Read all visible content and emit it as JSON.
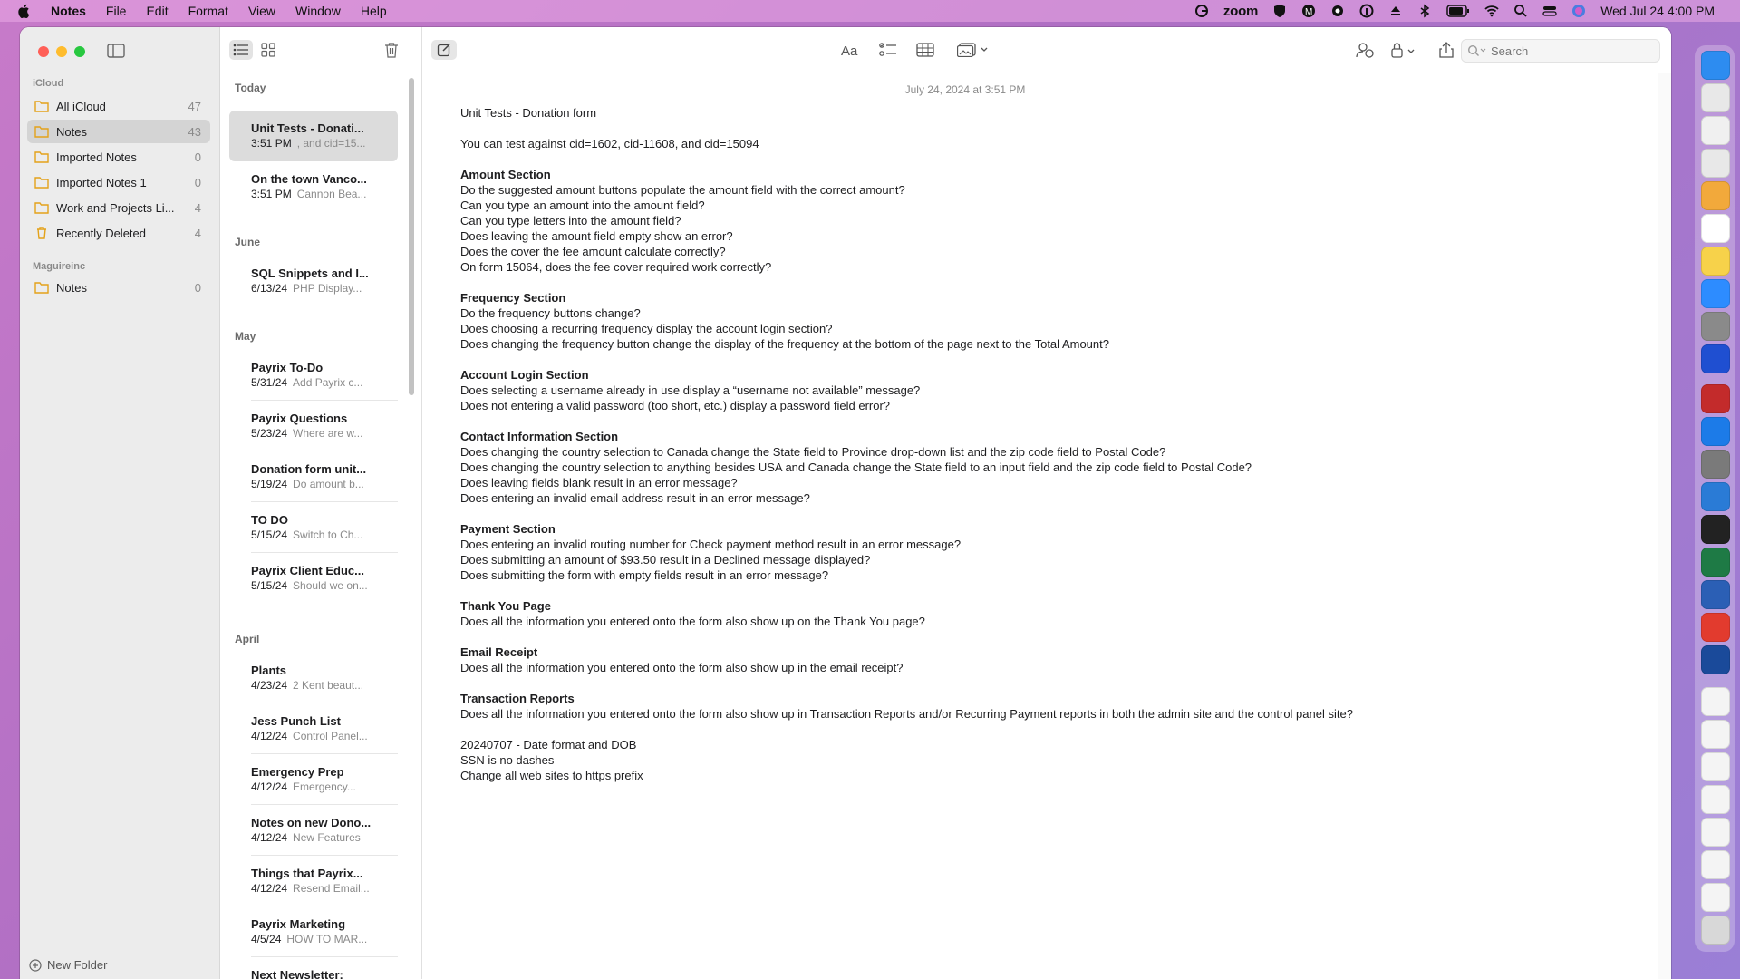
{
  "menubar": {
    "app_name": "Notes",
    "menus": [
      "File",
      "Edit",
      "Format",
      "View",
      "Window",
      "Help"
    ],
    "zoom_label": "zoom",
    "clock": "Wed Jul 24  4:00 PM"
  },
  "sidebar": {
    "groups": [
      {
        "label": "iCloud",
        "folders": [
          {
            "name": "All iCloud",
            "count": "47"
          },
          {
            "name": "Notes",
            "count": "43"
          },
          {
            "name": "Imported Notes",
            "count": "0"
          },
          {
            "name": "Imported Notes 1",
            "count": "0"
          },
          {
            "name": "Work and Projects Li...",
            "count": "4"
          },
          {
            "name": "Recently Deleted",
            "count": "4"
          }
        ]
      },
      {
        "label": "Maguireinc",
        "folders": [
          {
            "name": "Notes",
            "count": "0"
          }
        ]
      }
    ],
    "new_folder_label": "New Folder"
  },
  "notelist": {
    "sections": [
      {
        "label": "Today",
        "notes": [
          {
            "title": "Unit Tests - Donati...",
            "date": "3:51 PM",
            "preview": ", and cid=15..."
          },
          {
            "title": "On the town Vanco...",
            "date": "3:51 PM",
            "preview": "Cannon Bea..."
          }
        ]
      },
      {
        "label": "June",
        "notes": [
          {
            "title": "SQL Snippets and I...",
            "date": "6/13/24",
            "preview": "PHP Display..."
          }
        ]
      },
      {
        "label": "May",
        "notes": [
          {
            "title": "Payrix To-Do",
            "date": "5/31/24",
            "preview": "Add Payrix c..."
          },
          {
            "title": "Payrix Questions",
            "date": "5/23/24",
            "preview": "Where are w..."
          },
          {
            "title": "Donation form unit...",
            "date": "5/19/24",
            "preview": "Do amount b..."
          },
          {
            "title": "TO DO",
            "date": "5/15/24",
            "preview": "Switch to Ch..."
          },
          {
            "title": "Payrix Client Educ...",
            "date": "5/15/24",
            "preview": "Should we on..."
          }
        ]
      },
      {
        "label": "April",
        "notes": [
          {
            "title": "Plants",
            "date": "4/23/24",
            "preview": "2 Kent beaut..."
          },
          {
            "title": "Jess Punch List",
            "date": "4/12/24",
            "preview": "Control Panel..."
          },
          {
            "title": "Emergency Prep",
            "date": "4/12/24",
            "preview": "Emergency..."
          },
          {
            "title": "Notes on new Dono...",
            "date": "4/12/24",
            "preview": "New Features"
          },
          {
            "title": "Things that Payrix...",
            "date": "4/12/24",
            "preview": "Resend Email..."
          },
          {
            "title": "Payrix Marketing",
            "date": "4/5/24",
            "preview": "HOW TO MAR..."
          },
          {
            "title": "Next Newsletter:",
            "date": "",
            "preview": ""
          }
        ]
      }
    ]
  },
  "editor": {
    "search_placeholder": "Search",
    "note_date": "July 24, 2024 at 3:51 PM",
    "lines": [
      {
        "text": "Unit Tests - Donation form",
        "bold": false
      },
      {
        "text": "",
        "bold": false
      },
      {
        "text": "You can test against cid=1602, cid-11608, and cid=15094",
        "bold": false
      },
      {
        "text": "",
        "bold": false
      },
      {
        "text": "Amount Section",
        "bold": true
      },
      {
        "text": "Do the suggested amount buttons populate the amount field with the correct amount?",
        "bold": false
      },
      {
        "text": "Can you type an amount into the amount field?",
        "bold": false
      },
      {
        "text": "Can you type letters into the amount field?",
        "bold": false
      },
      {
        "text": "Does leaving the amount field empty show an error?",
        "bold": false
      },
      {
        "text": "Does the cover the fee amount calculate correctly?",
        "bold": false
      },
      {
        "text": "On form 15064, does the fee cover required work correctly?",
        "bold": false
      },
      {
        "text": "",
        "bold": false
      },
      {
        "text": "Frequency Section",
        "bold": true
      },
      {
        "text": "Do the frequency buttons change?",
        "bold": false
      },
      {
        "text": "Does choosing a recurring frequency display the account login section?",
        "bold": false
      },
      {
        "text": "Does changing the frequency button change the display of the frequency at the bottom of the page next to the Total Amount?",
        "bold": false
      },
      {
        "text": "",
        "bold": false
      },
      {
        "text": "Account Login Section",
        "bold": true
      },
      {
        "text": "Does selecting a username already in use display a “username not available” message?",
        "bold": false
      },
      {
        "text": "Does not entering a valid password (too short, etc.) display a password field error?",
        "bold": false
      },
      {
        "text": "",
        "bold": false
      },
      {
        "text": "Contact Information Section",
        "bold": true
      },
      {
        "text": "Does changing the country selection to Canada change the State field to Province drop-down list and the zip code field to Postal Code?",
        "bold": false
      },
      {
        "text": "Does changing the country selection to anything besides USA and Canada change the State field to an input field and the zip code field to Postal Code?",
        "bold": false
      },
      {
        "text": "Does leaving fields blank result in an error message?",
        "bold": false
      },
      {
        "text": "Does entering an invalid email address result in an error message?",
        "bold": false
      },
      {
        "text": "",
        "bold": false
      },
      {
        "text": "Payment Section",
        "bold": true
      },
      {
        "text": "Does entering an invalid routing number for Check payment method result in an error message?",
        "bold": false
      },
      {
        "text": "Does submitting an amount of $93.50 result in a Declined message displayed?",
        "bold": false
      },
      {
        "text": "Does submitting the form with empty fields result in an error message?",
        "bold": false
      },
      {
        "text": "",
        "bold": false
      },
      {
        "text": "Thank You Page",
        "bold": true
      },
      {
        "text": "Does all the information you entered onto the form also show up on the Thank You page?",
        "bold": false
      },
      {
        "text": "",
        "bold": false
      },
      {
        "text": "Email Receipt",
        "bold": true
      },
      {
        "text": "Does all the information you entered onto the form also show up in the email receipt?",
        "bold": false
      },
      {
        "text": "",
        "bold": false
      },
      {
        "text": "Transaction Reports",
        "bold": true
      },
      {
        "text": "Does all the information you entered onto the form also show up in Transaction Reports and/or Recurring Payment reports in both the admin site and the control panel site?",
        "bold": false
      },
      {
        "text": "",
        "bold": false
      },
      {
        "text": "20240707 - Date format and DOB",
        "bold": false
      },
      {
        "text": "SSN is no dashes",
        "bold": false
      },
      {
        "text": "Change all web sites to https prefix",
        "bold": false
      }
    ]
  },
  "colors": {
    "close": "#ff5f57",
    "minimize": "#febc2e",
    "maximize": "#28c840",
    "folder_accent": "#e3a21a"
  }
}
